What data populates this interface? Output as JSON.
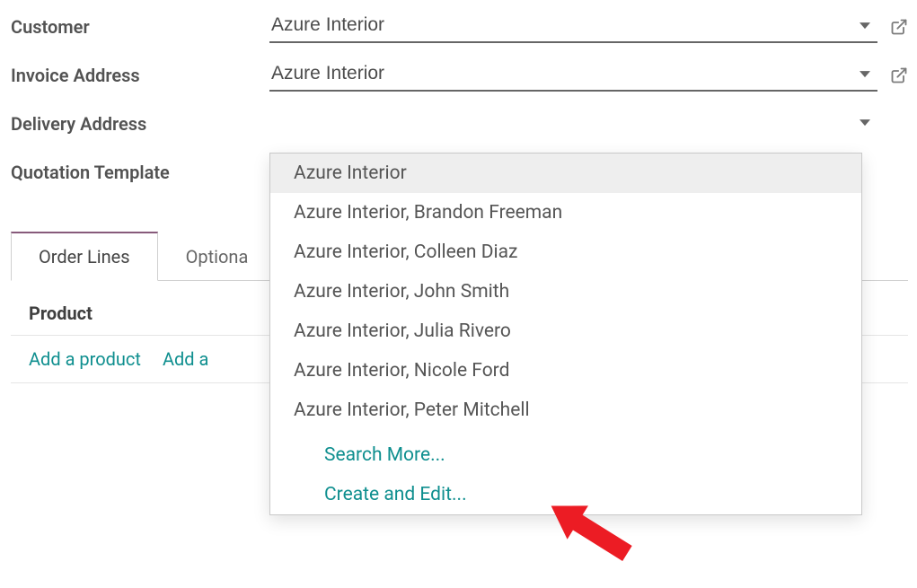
{
  "fields": {
    "customer": {
      "label": "Customer",
      "value": "Azure Interior"
    },
    "invoice_address": {
      "label": "Invoice Address",
      "value": "Azure Interior"
    },
    "delivery_address": {
      "label": "Delivery Address",
      "value": ""
    },
    "quote_template": {
      "label": "Quotation Template",
      "value": ""
    }
  },
  "tabs": {
    "order_lines": "Order Lines",
    "optional": "Optiona"
  },
  "list": {
    "header_product": "Product",
    "add_product": "Add a product",
    "add_section": "Add a"
  },
  "dropdown": {
    "opt0": "Azure Interior",
    "opt1": "Azure Interior, Brandon Freeman",
    "opt2": "Azure Interior, Colleen Diaz",
    "opt3": "Azure Interior, John Smith",
    "opt4": "Azure Interior, Julia Rivero",
    "opt5": "Azure Interior, Nicole Ford",
    "opt6": "Azure Interior, Peter Mitchell",
    "search_more": "Search More...",
    "create_and_edit": "Create and Edit..."
  }
}
